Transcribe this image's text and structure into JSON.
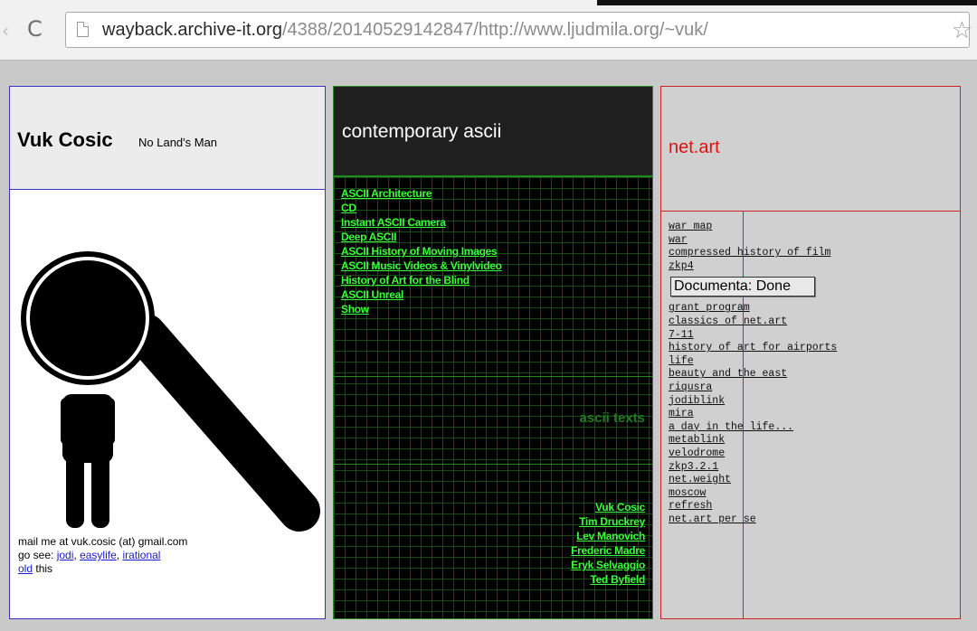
{
  "browser": {
    "url_domain": "wayback.archive-it.org",
    "url_path": "/4388/20140529142847/http://www.ljudmila.org/~vuk/",
    "back_glyph": "‹",
    "reload_glyph": "C",
    "star_glyph": "☆",
    "icons": [
      "back-arrow-icon",
      "reload-icon",
      "page-icon",
      "bookmark-star-icon"
    ]
  },
  "left": {
    "name": "Vuk Cosic",
    "tagline": "No Land's Man",
    "mail_text": "mail me at vuk.cosic (at) gmail.com",
    "go_see_text": "go see:",
    "go_links": [
      "jodi",
      "easylife",
      "irational"
    ],
    "old_link": "old",
    "this_text": "this",
    "illustration": "magnifying-glass-person-icon"
  },
  "middle": {
    "title": "contemporary ascii",
    "links": [
      "ASCII Architecture",
      "CD",
      "Instant ASCII Camera",
      "Deep ASCII",
      "ASCII History of Moving Images",
      "ASCII Music Videos & Vinylvideo",
      "History of Art for the Blind",
      "ASCII Unreal",
      "Show"
    ],
    "texts_label": "ascii texts",
    "names": [
      "Vuk Cosic",
      "Tim Druckrey",
      "Lev Manovich",
      "Frederic Madre",
      "Eryk Selvaggio",
      "Ted Byfield"
    ]
  },
  "right": {
    "title": "net.art",
    "links_a": [
      "war map",
      "war",
      "compressed history of film",
      "zkp4"
    ],
    "documenta": "Documenta: Done",
    "links_b": [
      "grant program",
      "classics of net.art",
      "7-11",
      "history of art for airports",
      "life",
      "beauty and the east",
      "riqusra",
      "jodiblink",
      "mira",
      "a day in the life...",
      "metablink",
      "velodrome",
      "zkp3.2.1",
      "net.weight",
      "moscow",
      "refresh",
      "net.art per se"
    ]
  },
  "colors": {
    "left_border": "#3535c8",
    "middle_border": "#238a23",
    "ascii_link": "#37ff37",
    "right_border": "#cc2222",
    "netart_title": "#e01010"
  }
}
